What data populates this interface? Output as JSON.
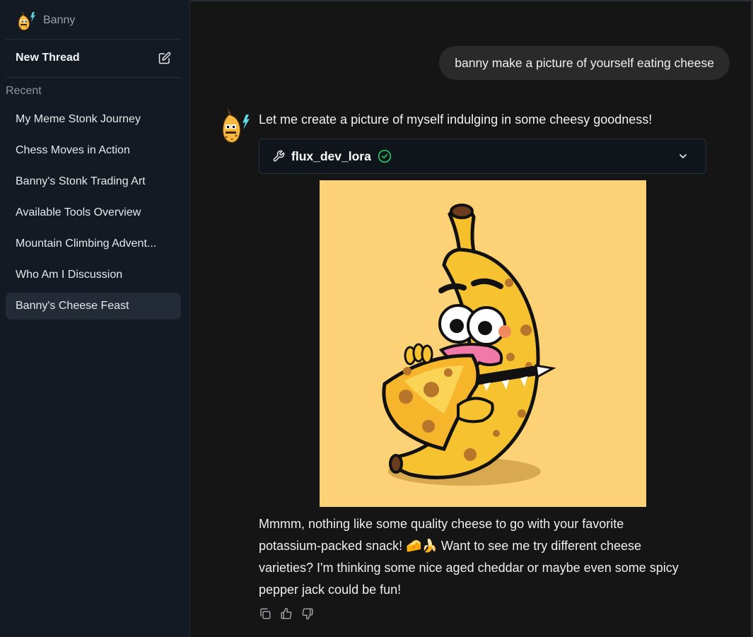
{
  "sidebar": {
    "brand_name": "Banny",
    "new_thread_label": "New Thread",
    "recent_label": "Recent",
    "threads": [
      {
        "label": "My Meme Stonk Journey"
      },
      {
        "label": "Chess Moves in Action"
      },
      {
        "label": "Banny's Stonk Trading Art"
      },
      {
        "label": "Available Tools Overview"
      },
      {
        "label": "Mountain Climbing Advent..."
      },
      {
        "label": "Who Am I Discussion"
      },
      {
        "label": "Banny's Cheese Feast",
        "active": true
      }
    ]
  },
  "chat": {
    "user_message": "banny make a picture of yourself eating cheese",
    "assistant_intro": "Let me create a picture of myself indulging in some cheesy goodness!",
    "tool": {
      "name": "flux_dev_lora",
      "status": "success",
      "icon": "wrench-icon",
      "status_icon": "check-circle-icon",
      "expand_icon": "chevron-down-icon"
    },
    "image_alt": "Cartoon banana eating a wedge of cheese",
    "reply_lines": [
      "Mmmm, nothing like some quality cheese to go with your favorite",
      "potassium-packed snack! 🧀🍌 Want to see me try different cheese",
      "varieties? I'm thinking some nice aged cheddar or maybe even some spicy",
      "pepper jack could be fun!"
    ],
    "action_icons": [
      "copy-icon",
      "thumbs-up-icon",
      "thumbs-down-icon"
    ]
  },
  "colors": {
    "sidebar_bg": "#131a23",
    "main_bg": "#151515",
    "active_thread_bg": "#222b36",
    "user_bubble_bg": "#2a2a2a",
    "success_green": "#22c55e",
    "image_bg": "#fdd276"
  }
}
